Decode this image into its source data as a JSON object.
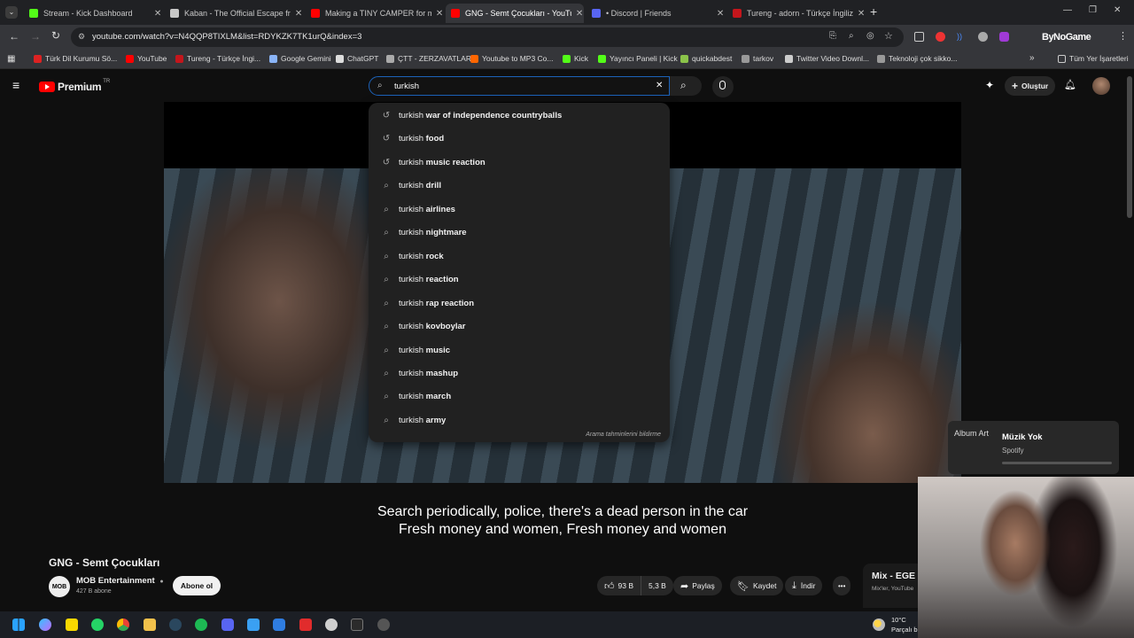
{
  "browser": {
    "tabs": [
      {
        "title": "Stream - Kick Dashboard",
        "color": "#53fc18",
        "active": false
      },
      {
        "title": "Kaban - The Official Escape fro",
        "color": "#c8c8c8",
        "active": false
      },
      {
        "title": "Making a TINY CAMPER for my",
        "color": "#ff0000",
        "active": false
      },
      {
        "title": "GNG - Semt Çocukları - YouTube",
        "color": "#ff0000",
        "active": true
      },
      {
        "title": "• Discord | Friends",
        "color": "#5865f2",
        "active": false
      },
      {
        "title": "Tureng - adorn - Türkçe İngiliz",
        "color": "#c4161c",
        "active": false
      }
    ],
    "new_tab_symbol": "+",
    "url": "youtube.com/watch?v=N4QQP8TIXLM&list=RDYKZK7TK1urQ&index=3",
    "extension_label": "ByNoGame",
    "bookmarks": [
      {
        "label": "Türk Dil Kurumu Sö...",
        "color": "#d22"
      },
      {
        "label": "YouTube",
        "color": "#f00"
      },
      {
        "label": "Tureng - Türkçe İngi...",
        "color": "#c4161c"
      },
      {
        "label": "Google Gemini",
        "color": "#8ab4f8"
      },
      {
        "label": "ChatGPT",
        "color": "#ddd"
      },
      {
        "label": "ÇTT - ZERZAVATLAR",
        "color": "#aaa"
      },
      {
        "label": "Youtube to MP3 Co...",
        "color": "#f60"
      },
      {
        "label": "Kick",
        "color": "#53fc18"
      },
      {
        "label": "Yayıncı Paneli | Kick",
        "color": "#53fc18"
      },
      {
        "label": "quickabdest",
        "color": "#8bc34a"
      },
      {
        "label": "tarkov",
        "color": "#999"
      },
      {
        "label": "Twitter Video Downl...",
        "color": "#ccc"
      },
      {
        "label": "Teknoloji çok sikko...",
        "color": "#999"
      }
    ],
    "all_bookmarks_label": "Tüm Yer İşaretleri"
  },
  "youtube": {
    "logo_text": "Premium",
    "logo_region": "TR",
    "search": {
      "value": "turkish",
      "clear_symbol": "✕"
    },
    "create_label": "Oluştur",
    "suggestions": [
      {
        "prefix": "turkish",
        "rest": "war of independence countryballs",
        "history": true
      },
      {
        "prefix": "turkish",
        "rest": "food",
        "history": true
      },
      {
        "prefix": "turkish",
        "rest": "music reaction",
        "history": true
      },
      {
        "prefix": "turkish",
        "rest": "drill",
        "history": false
      },
      {
        "prefix": "turkish",
        "rest": "airlines",
        "history": false
      },
      {
        "prefix": "turkish",
        "rest": "nightmare",
        "history": false
      },
      {
        "prefix": "turkish",
        "rest": "rock",
        "history": false
      },
      {
        "prefix": "turkish",
        "rest": "reaction",
        "history": false
      },
      {
        "prefix": "turkish",
        "rest": "rap reaction",
        "history": false
      },
      {
        "prefix": "turkish",
        "rest": "kovboylar",
        "history": false
      },
      {
        "prefix": "turkish",
        "rest": "music",
        "history": false
      },
      {
        "prefix": "turkish",
        "rest": "mashup",
        "history": false
      },
      {
        "prefix": "turkish",
        "rest": "march",
        "history": false
      },
      {
        "prefix": "turkish",
        "rest": "army",
        "history": false
      }
    ],
    "report_label": "Arama tahminlerini bildirme",
    "subtitles": {
      "line1": "Search periodically, police, there's a dead person in the car",
      "line2": "Fresh money and women, Fresh money and women"
    },
    "video": {
      "title": "GNG - Semt Çocukları",
      "channel": "MOB Entertainment",
      "channel_logo": "MOB",
      "subscribers": "427 B abone",
      "subscribe_label": "Abone ol",
      "likes": "93 B",
      "dislikes": "5,3 B",
      "share_label": "Paylaş",
      "save_label": "Kaydet",
      "download_label": "İndir",
      "more_symbol": "•••"
    },
    "mix": {
      "title": "Mix - EGE",
      "subtitle": "Mix'ler, YouTube"
    }
  },
  "spotify_widget": {
    "album_art_alt": "Album Art",
    "status": "Müzik Yok",
    "source": "Spotify"
  },
  "taskbar": {
    "weather_temp": "10°C",
    "weather_desc": "Parçalı b"
  }
}
